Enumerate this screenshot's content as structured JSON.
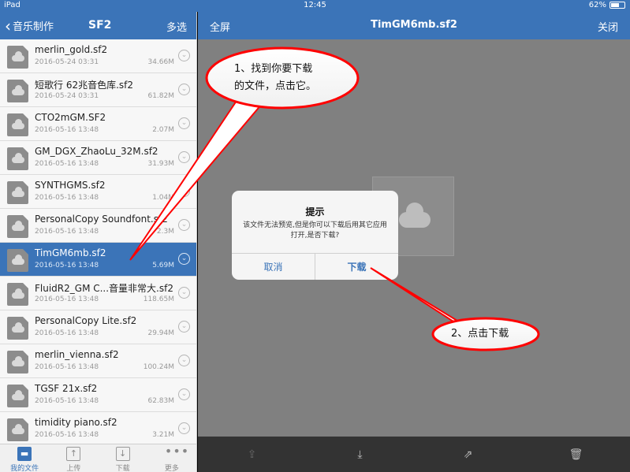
{
  "status_bar": {
    "device": "iPad",
    "time": "12:45",
    "battery": "62%",
    "battery_level": 0.62
  },
  "left_nav": {
    "back_label": "音乐制作",
    "title": "SF2",
    "multi_select": "多选"
  },
  "files": [
    {
      "name": "merlin_gold.sf2",
      "date": "2016-05-24 03:31",
      "size": "34.66M"
    },
    {
      "name": "短歌行 62兆音色库.sf2",
      "date": "2016-05-24 03:31",
      "size": "61.82M"
    },
    {
      "name": "CTO2mGM.SF2",
      "date": "2016-05-16 13:48",
      "size": "2.07M"
    },
    {
      "name": "GM_DGX_ZhaoLu_32M.sf2",
      "date": "2016-05-16 13:48",
      "size": "31.93M"
    },
    {
      "name": "SYNTHGMS.sf2",
      "date": "2016-05-16 13:48",
      "size": "1.04M"
    },
    {
      "name": "PersonalCopy Soundfont.sf2",
      "date": "2016-05-16 13:48",
      "size": "2.3M"
    },
    {
      "name": "TimGM6mb.sf2",
      "date": "2016-05-16 13:48",
      "size": "5.69M",
      "selected": true
    },
    {
      "name": "FluidR2_GM C...音量非常大.sf2",
      "date": "2016-05-16 13:48",
      "size": "118.65M"
    },
    {
      "name": "PersonalCopy Lite.sf2",
      "date": "2016-05-16 13:48",
      "size": "29.94M"
    },
    {
      "name": "merlin_vienna.sf2",
      "date": "2016-05-16 13:48",
      "size": "100.24M"
    },
    {
      "name": "TGSF 21x.sf2",
      "date": "2016-05-16 13:48",
      "size": "62.83M"
    },
    {
      "name": "timidity piano.sf2",
      "date": "2016-05-16 13:48",
      "size": "3.21M"
    }
  ],
  "tabs": [
    {
      "label": "我的文件",
      "icon": "folder-icon",
      "active": true
    },
    {
      "label": "上传",
      "icon": "upload-icon"
    },
    {
      "label": "下载",
      "icon": "download-icon"
    },
    {
      "label": "更多",
      "icon": "more-icon"
    }
  ],
  "right_nav": {
    "fullscreen": "全屏",
    "title": "TimGM6mb.sf2",
    "close": "关闭"
  },
  "dialog": {
    "title": "提示",
    "message": "该文件无法预览,但是你可以下载后用其它应用打开,是否下载?",
    "cancel": "取消",
    "download": "下载"
  },
  "annotations": {
    "step1_line1": "1、找到你要下载",
    "step1_line2": "的文件，点击它。",
    "step2": "2、点击下载"
  },
  "colors": {
    "accent": "#3b74b8",
    "callout_border": "#ff0000"
  }
}
